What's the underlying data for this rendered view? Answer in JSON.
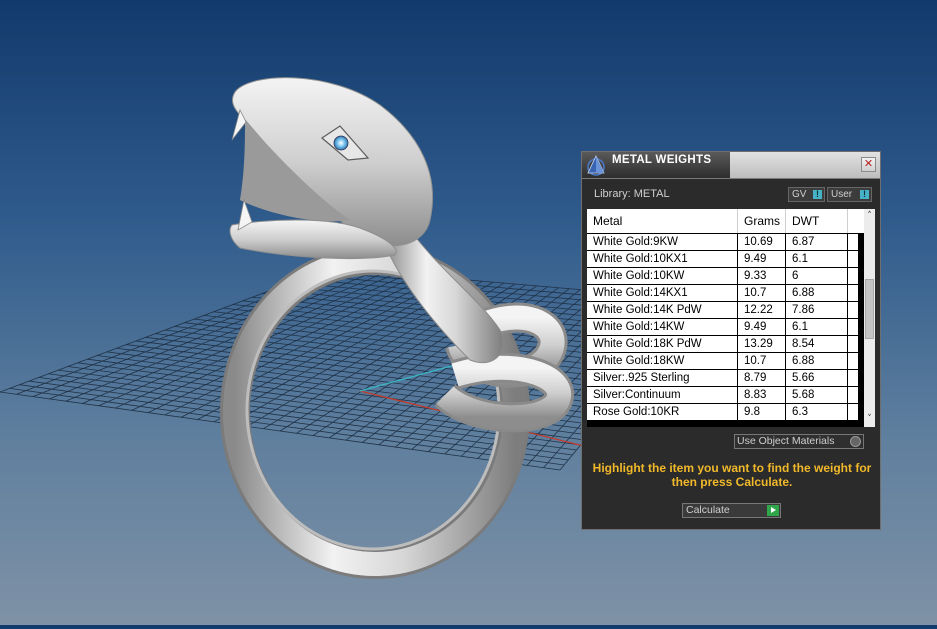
{
  "panel": {
    "title": "METAL WEIGHTS",
    "close_symbol": "✕",
    "library_label": "Library: METAL",
    "toggles": {
      "gv": "GV",
      "user": "User",
      "indicator": "!"
    },
    "table": {
      "headers": [
        "Metal",
        "Grams",
        "DWT"
      ],
      "rows": [
        {
          "metal": "White Gold:9KW",
          "grams": "10.69",
          "dwt": "6.87"
        },
        {
          "metal": "White Gold:10KX1",
          "grams": "9.49",
          "dwt": "6.1"
        },
        {
          "metal": "White Gold:10KW",
          "grams": "9.33",
          "dwt": "6"
        },
        {
          "metal": "White Gold:14KX1",
          "grams": "10.7",
          "dwt": "6.88"
        },
        {
          "metal": "White Gold:14K PdW",
          "grams": "12.22",
          "dwt": "7.86"
        },
        {
          "metal": "White Gold:14KW",
          "grams": "9.49",
          "dwt": "6.1"
        },
        {
          "metal": "White Gold:18K PdW",
          "grams": "13.29",
          "dwt": "8.54"
        },
        {
          "metal": "White Gold:18KW",
          "grams": "10.7",
          "dwt": "6.88"
        },
        {
          "metal": "Silver:.925 Sterling",
          "grams": "8.79",
          "dwt": "5.66"
        },
        {
          "metal": "Silver:Continuum",
          "grams": "8.83",
          "dwt": "5.68"
        },
        {
          "metal": "Rose Gold:10KR",
          "grams": "9.8",
          "dwt": "6.3"
        }
      ],
      "scroll_up": "˄",
      "scroll_down": "˅"
    },
    "use_object_materials": "Use Object Materials",
    "hint": "Highlight the item you want to find the weight for then press Calculate.",
    "calculate_label": "Calculate"
  },
  "icons": {
    "app": "pyramid-icon",
    "close": "close-icon",
    "calc_arrow": "play-arrow-icon"
  },
  "colors": {
    "accent_cyan": "#46b3c7",
    "hint_yellow": "#f1b92a",
    "calc_green": "#2fa64a"
  }
}
